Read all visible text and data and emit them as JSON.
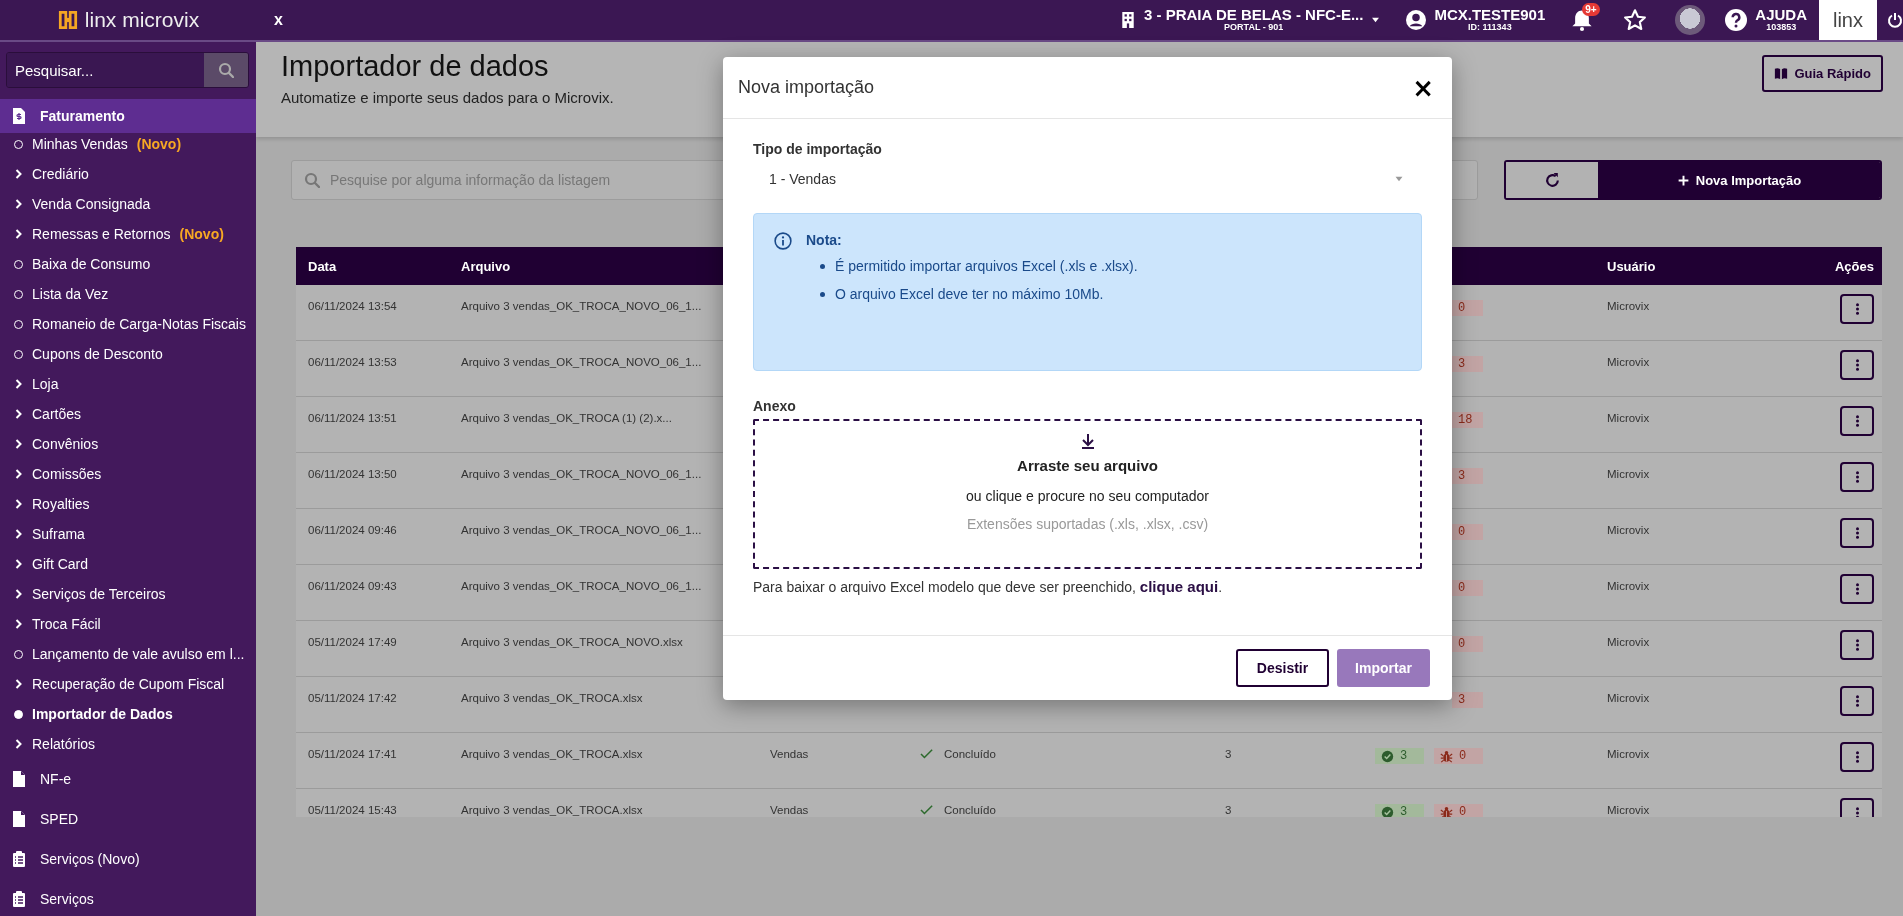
{
  "topbar": {
    "logo": "linx microvix",
    "close_label": "x",
    "store": {
      "name": "3 - PRAIA DE BELAS - NFC-E...",
      "sub": "PORTAL - 901"
    },
    "user": {
      "name": "MCX.TESTE901",
      "sub": "ID: 111343"
    },
    "notifications": {
      "badge": "9+"
    },
    "help": {
      "label": "AJUDA",
      "sub": "103853"
    },
    "brand": "linx"
  },
  "sidebar": {
    "search": {
      "placeholder": "Pesquisar..."
    },
    "sections": [
      {
        "label": "Faturamento",
        "selected": true,
        "items": [
          {
            "label": "Minhas Vendas",
            "badge": "(Novo)",
            "kind": "link",
            "selected": false
          },
          {
            "label": "Crediário",
            "kind": "group",
            "selected": false
          },
          {
            "label": "Venda Consignada",
            "kind": "group",
            "selected": false
          },
          {
            "label": "Remessas e Retornos",
            "badge": "(Novo)",
            "kind": "group",
            "selected": false
          },
          {
            "label": "Baixa de Consumo",
            "kind": "link",
            "selected": false
          },
          {
            "label": "Lista da Vez",
            "kind": "link",
            "selected": false
          },
          {
            "label": "Romaneio de Carga-Notas Fiscais",
            "kind": "link",
            "selected": false
          },
          {
            "label": "Cupons de Desconto",
            "kind": "link",
            "selected": false
          },
          {
            "label": "Loja",
            "kind": "group",
            "selected": false
          },
          {
            "label": "Cartões",
            "kind": "group",
            "selected": false
          },
          {
            "label": "Convênios",
            "kind": "group",
            "selected": false
          },
          {
            "label": "Comissões",
            "kind": "group",
            "selected": false
          },
          {
            "label": "Royalties",
            "kind": "group",
            "selected": false
          },
          {
            "label": "Suframa",
            "kind": "group",
            "selected": false
          },
          {
            "label": "Gift Card",
            "kind": "group",
            "selected": false
          },
          {
            "label": "Serviços de Terceiros",
            "kind": "group",
            "selected": false
          },
          {
            "label": "Troca Fácil",
            "kind": "group",
            "selected": false
          },
          {
            "label": "Lançamento de vale avulso em l...",
            "kind": "link",
            "selected": false
          },
          {
            "label": "Recuperação de Cupom Fiscal",
            "kind": "group",
            "selected": false
          },
          {
            "label": "Importador de Dados",
            "kind": "link",
            "selected": true
          },
          {
            "label": "Relatórios",
            "kind": "group",
            "selected": false
          }
        ]
      },
      {
        "label": "NF-e",
        "selected": false
      },
      {
        "label": "SPED",
        "selected": false
      },
      {
        "label": "Serviços (Novo)",
        "selected": false
      },
      {
        "label": "Serviços",
        "selected": false
      }
    ]
  },
  "page": {
    "title": "Importador de dados",
    "subtitle": "Automatize e importe seus dados para o Microvix.",
    "guide_button": "Guia Rápido",
    "search": {
      "placeholder": "Pesquise por alguma informação da listagem"
    },
    "new_button": "Nova Importação"
  },
  "table": {
    "columns": [
      "Data",
      "Arquivo",
      "Usuário",
      "Ações"
    ],
    "rows": [
      {
        "date": "06/11/2024 13:54",
        "file": "Arquivo 3 vendas_OK_TROCA_NOVO_06_1...",
        "errors": "0",
        "user": "Microvix"
      },
      {
        "date": "06/11/2024 13:53",
        "file": "Arquivo 3 vendas_OK_TROCA_NOVO_06_1...",
        "errors": "3",
        "user": "Microvix"
      },
      {
        "date": "06/11/2024 13:51",
        "file": "Arquivo 3 vendas_OK_TROCA (1) (2).x...",
        "errors": "18",
        "user": "Microvix"
      },
      {
        "date": "06/11/2024 13:50",
        "file": "Arquivo 3 vendas_OK_TROCA_NOVO_06_1...",
        "errors": "3",
        "user": "Microvix"
      },
      {
        "date": "06/11/2024 09:46",
        "file": "Arquivo 3 vendas_OK_TROCA_NOVO_06_1...",
        "errors": "0",
        "user": "Microvix"
      },
      {
        "date": "06/11/2024 09:43",
        "file": "Arquivo 3 vendas_OK_TROCA_NOVO_06_1...",
        "errors": "0",
        "user": "Microvix"
      },
      {
        "date": "05/11/2024 17:49",
        "file": "Arquivo 3 vendas_OK_TROCA_NOVO.xlsx",
        "errors": "0",
        "user": "Microvix"
      },
      {
        "date": "05/11/2024 17:42",
        "file": "Arquivo 3 vendas_OK_TROCA.xlsx",
        "errors": "3",
        "user": "Microvix"
      },
      {
        "date": "05/11/2024 17:41",
        "file": "Arquivo 3 vendas_OK_TROCA.xlsx",
        "type": "Vendas",
        "status": "Concluído",
        "total": "3",
        "success": "3",
        "errors": "0",
        "user": "Microvix"
      },
      {
        "date": "05/11/2024 15:43",
        "file": "Arquivo 3 vendas_OK_TROCA.xlsx",
        "type": "Vendas",
        "status": "Concluído",
        "total": "3",
        "success": "3",
        "errors": "0",
        "user": "Microvix"
      }
    ]
  },
  "modal": {
    "title": "Nova importação",
    "close": "×",
    "type_label": "Tipo de importação",
    "type_value": "1 - Vendas",
    "note": {
      "title": "Nota:",
      "items": [
        "É permitido importar arquivos Excel (.xls e .xlsx).",
        "O arquivo Excel deve ter no máximo 10Mb."
      ]
    },
    "attachment_label": "Anexo",
    "drop": {
      "title": "Arraste seu arquivo",
      "text": "ou clique e procure no seu computador",
      "hint": "Extensões suportadas (.xls, .xlsx, .csv)"
    },
    "template_text": "Para baixar o arquivo Excel modelo que deve ser preenchido,",
    "template_link": "clique aqui",
    "template_end": ".",
    "buttons": [
      {
        "label": "Desistir",
        "kind": "secondary",
        "disabled": false
      },
      {
        "label": "Importar",
        "kind": "primary",
        "disabled": true
      }
    ]
  }
}
